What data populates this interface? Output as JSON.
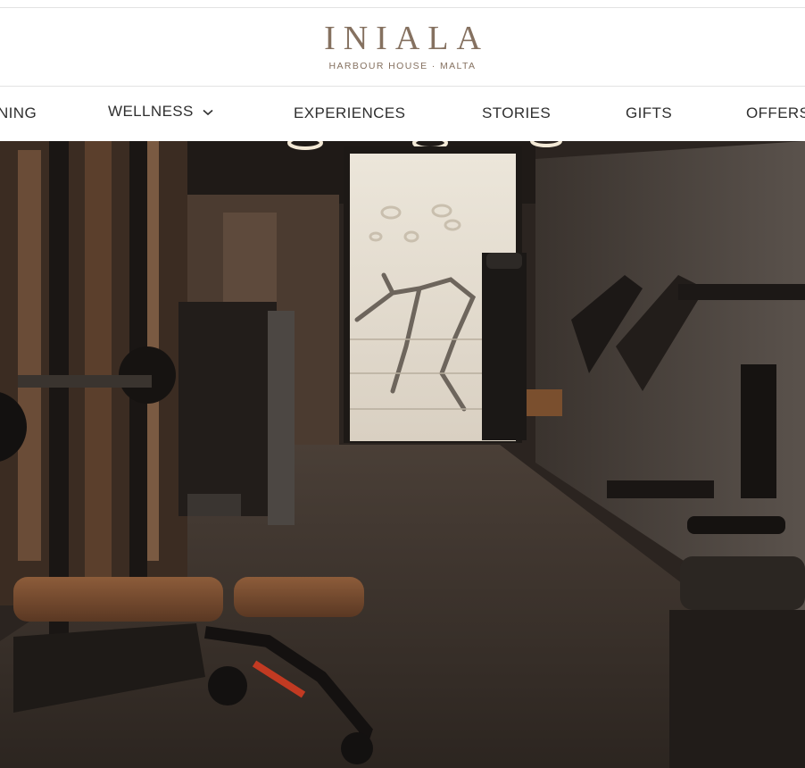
{
  "brand": {
    "name": "INIALA",
    "subtitle": "HARBOUR HOUSE · MALTA"
  },
  "nav": {
    "items": [
      {
        "label": "NING"
      },
      {
        "label": "WELLNESS",
        "has_dropdown": true
      },
      {
        "label": "EXPERIENCES"
      },
      {
        "label": "STORIES"
      },
      {
        "label": "GIFTS"
      },
      {
        "label": "OFFERS"
      }
    ]
  },
  "colors": {
    "brand": "#857160",
    "nav_text": "#2f2f2f",
    "divider": "#e2e2e2"
  },
  "hero": {
    "icon": "gym-interior-photo"
  }
}
